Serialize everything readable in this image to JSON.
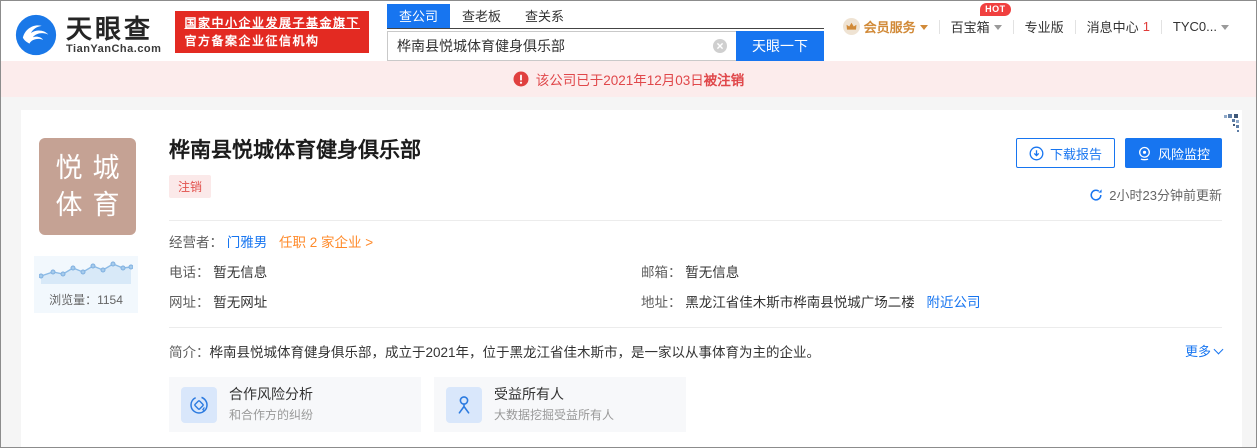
{
  "header": {
    "logo": {
      "title": "天眼查",
      "domain": "TianYanCha.com"
    },
    "cert_badge": {
      "line1": "国家中小企业发展子基金旗下",
      "line2": "官方备案企业征信机构"
    },
    "search": {
      "tabs": [
        {
          "label": "查公司",
          "active": true
        },
        {
          "label": "查老板",
          "active": false
        },
        {
          "label": "查关系",
          "active": false
        }
      ],
      "value": "桦南县悦城体育健身俱乐部",
      "button": "天眼一下"
    },
    "nav": {
      "vip": "会员服务",
      "toolbox": "百宝箱",
      "toolbox_badge": "HOT",
      "pro": "专业版",
      "messages": "消息中心",
      "messages_count": "1",
      "account": "TYC0..."
    }
  },
  "alert": {
    "prefix": "该公司已于2021年12月03日",
    "bold": "被注销"
  },
  "company": {
    "avatar_line1": "悦城",
    "avatar_line2": "体育",
    "name": "桦南县悦城体育健身俱乐部",
    "status": "注销",
    "download_button": "下载报告",
    "monitor_button": "风险监控",
    "updated": "2小时23分钟前更新",
    "views_label": "浏览量：",
    "views_value": "1154"
  },
  "info": {
    "operator_label": "经营者：",
    "operator_name": "门雅男",
    "operator_link": "任职 2 家企业 >",
    "phone_label": "电话：",
    "phone_value": "暂无信息",
    "email_label": "邮箱：",
    "email_value": "暂无信息",
    "website_label": "网址：",
    "website_value": "暂无网址",
    "address_label": "地址：",
    "address_value": "黑龙江省佳木斯市桦南县悦城广场二楼",
    "address_link": "附近公司",
    "intro_label": "简介：",
    "intro_text": "桦南县悦城体育健身俱乐部，成立于2021年，位于黑龙江省佳木斯市，是一家以从事体育为主的企业。",
    "more_link": "更多"
  },
  "feature_cards": [
    {
      "title": "合作风险分析",
      "subtitle": "和合作方的纠纷"
    },
    {
      "title": "受益所有人",
      "subtitle": "大数据挖掘受益所有人"
    }
  ],
  "colors": {
    "brand_blue": "#1775f0",
    "alert_red": "#e0474a",
    "badge_red": "#e32a22",
    "orange_link": "#ff8a2a",
    "avatar_bg": "#c5a294"
  }
}
